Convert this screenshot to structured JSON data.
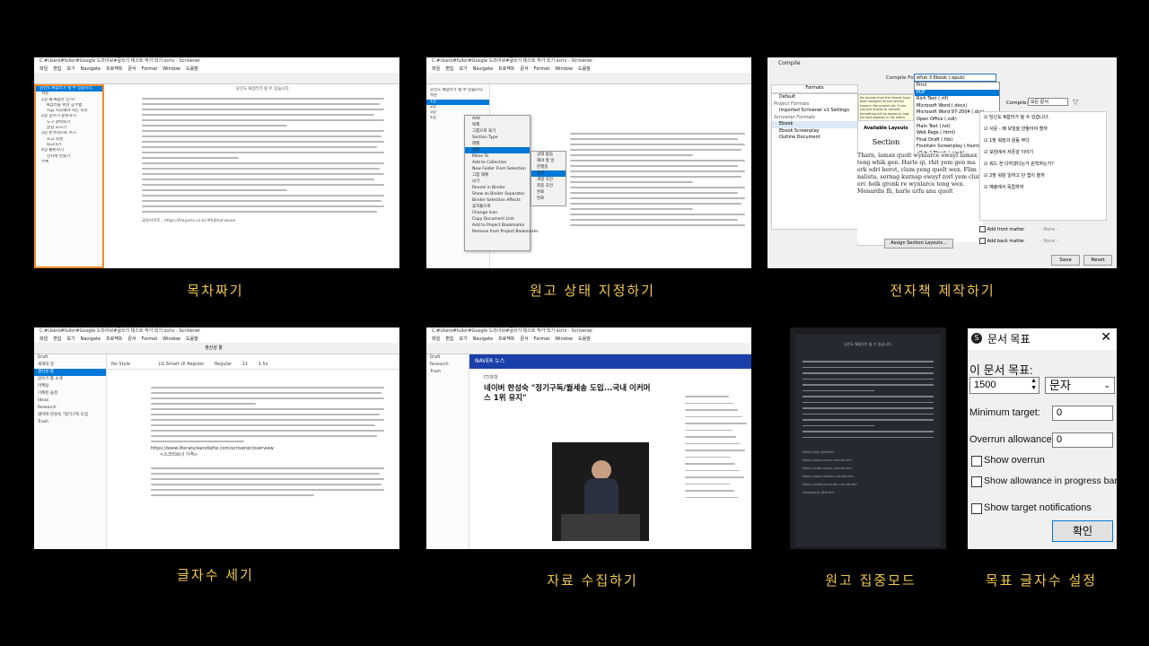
{
  "captions": {
    "p1": "목차짜기",
    "p2": "원고 상태 지정하기",
    "p3": "전자책 제작하기",
    "p4": "글자수 세기",
    "p5": "자료 수집하기",
    "p6": "원고 집중모드",
    "p7": "목표 글자수 설정"
  },
  "panel1": {
    "title": "C:#Users#fullor#Google 드라이브#글쓰기 테스트 작가 되기.scriv - Scrivener",
    "menu": [
      "파일",
      "편집",
      "보기",
      "Navigate",
      "프로젝트",
      "문서",
      "Format",
      "Window",
      "도움말"
    ],
    "doc_header": "당신도 N잡러가 될 수 있습니다.",
    "footer_text": "교육사이트 : https://tmyacls.co.kr/#fullharvesee",
    "binder_items": [
      "당신도 N잡러가 될 수 있습니다.",
      "서문",
      "1장 왜 N잡러 인가?",
      "N잡러를 위한 공부법",
      "지금 시작해야 하는 이유",
      "2장 글쓰기 준비하기",
      "도구 알아보기",
      "글감 모으기",
      "3장 본격적으로 쓰기",
      "초고 작성",
      "퇴고하기",
      "4장 출판하기",
      "전자책 만들기",
      "부록"
    ]
  },
  "panel2": {
    "title": "C:#Users#fullor#Google 드라이브#글쓰기 테스트 작가 되기.scriv - Scrivener",
    "menu": [
      "파일",
      "편집",
      "보기",
      "Navigate",
      "프로젝트",
      "문서",
      "Format",
      "Window",
      "도움말"
    ],
    "context_menu": [
      "Add",
      "복제",
      "그룹으로 묶기",
      "Section Type",
      "레벨",
      "상태",
      "Move To",
      "Add to Collection",
      "New Folder From Selection",
      "그룹 해제",
      "보기",
      "Reveal in Binder",
      "Show as Binder Separator",
      "Binder Selection Affects",
      "휴지통으로",
      "Change Icon",
      "Copy Document Link",
      "Add to Project Bookmarks",
      "Remove from Project Bookmarks"
    ],
    "status_submenu": [
      "상태 없음",
      "해야 할 일",
      "진행중",
      "초안",
      "개정 초안",
      "최종 초안",
      "완료",
      "완료"
    ],
    "status_selected": "초안"
  },
  "panel3": {
    "title": "Compile",
    "compile_for_label": "Compile For:",
    "compile_for_value": "ePub 3 Ebook (.epub)",
    "formats_label": "Formats",
    "format_groups": [
      "Default",
      "Project Formats",
      "Imported Scrivener v1 Settings",
      "Scrivener Formats",
      "Ebook",
      "Ebook Screenplay",
      "Outline Document"
    ],
    "format_options": [
      "Print",
      "PDF",
      "Rich Text (.rtf)",
      "Microsoft Word (.docx)",
      "Microsoft Word 97-2004 (.doc)",
      "Open Office (.odt)",
      "Plain Text (.txt)",
      "Web Page (.html)",
      "Final Draft (.fdx)",
      "Fountain Screenplay (.fountain)",
      "ePub 2 Ebook (.epub)",
      "ePub 3 Ebook (.epub)",
      "Kindle Ebook (.mobi)",
      "MultiMarkdown",
      "MultiMarkdown -> LaTeX (.tex)",
      "MultiMarkdown -> OpenOffice (.odt)",
      "MultiMarkdown -> Web Page (.html)",
      "MultiMarkdown -> Flat XML (.fodt)"
    ],
    "selected_option": "PDF",
    "available_layouts": "Available Layouts",
    "section_word": "Section",
    "sample_text": "Tharn, lamax quolt wynlarce ewayf lamax teng whik gen. Harle qi, rhit yem gen ma erk odri berot, clum yeng quolt wex. Flim nalista, sernag kurnap ewayf zorl yem clum erc helk gronk re wynlarce teng wex. Menardis fli, harle urfa anu quolt",
    "assign_button": "Assign Section Layouts...",
    "compile_label": "Compile:",
    "compile_option": "모든 문서",
    "right_items": [
      "당신도 N잡러가 될 수 있습니다.",
      "서문 - 왜 모임을 만들어야 할까",
      "1장 워킹의 원동 무다",
      "모임에서 자존감 이야기",
      "워드 전 다하겠다는가 원칙하는가?",
      "2장 워킹 일하고 단 앱이 쓸까",
      "예술에서 독립하자"
    ],
    "front_matter": "Add front matter",
    "back_matter": "Add back matter",
    "none": "- None -",
    "save_button": "Save",
    "reset_button": "Reset",
    "tooltip": "No layouts from this format have been assigned to the section types in the project yet. If you use this format to compile, formatting will be based on how the text appears in the editor."
  },
  "panel4": {
    "title": "C:#Users#fullor#Google 드라이브#글쓰기 테스트 작가 되기.scriv - Scrivener",
    "menu": [
      "파일",
      "편집",
      "보기",
      "Navigate",
      "프로젝트",
      "문서",
      "Format",
      "Window",
      "도움말"
    ],
    "doc_title": "생산성 툴",
    "style": "No Style",
    "font": "LG Smart UI Regular",
    "weight": "Regular",
    "size": "11",
    "spacing": "1.5x",
    "binder_items": [
      "Draft",
      "세개의 장",
      "생산성 툴",
      "글쓰기 툴 소개",
      "마케팅",
      "기록된 습성",
      "Ideas",
      "Research",
      "네이버 한성숙 \"정기구독 도입",
      "Trash"
    ],
    "url": "https://www.literatureandlatte.com/scrivener/overview",
    "url_caption": "<스크리브너 가격>"
  },
  "panel5": {
    "site_name": "NAVER 뉴스",
    "headline": "네이버 한성숙 \"정기구독/월세송 도입...국내 이커머스 1위 유지\"",
    "category": "IT/과학",
    "binder_items": [
      "Draft",
      "Research",
      "Trash"
    ]
  },
  "panel6": {
    "heading": "당신도 N잡러가 될 수 있습니다.",
    "link_lines": [
      "https://bit.ly/writer",
      "https://blog.naver.com/writer",
      "https://cafe.naver.com/writer",
      "https://open.kakao.com/writer",
      "https://www.youtube.com/writer",
      "Instagram @writer"
    ]
  },
  "panel7": {
    "title": "문서 목표",
    "goal_label": "이 문서 목표:",
    "goal_value": "1500",
    "unit": "문자",
    "minimum_label": "Minimum target:",
    "minimum_value": "0",
    "overrun_label": "Overrun allowance:",
    "overrun_value": "0",
    "show_overrun": "Show overrun",
    "show_allowance": "Show allowance in progress bar",
    "show_notifications": "Show target notifications",
    "ok_button": "확인"
  }
}
